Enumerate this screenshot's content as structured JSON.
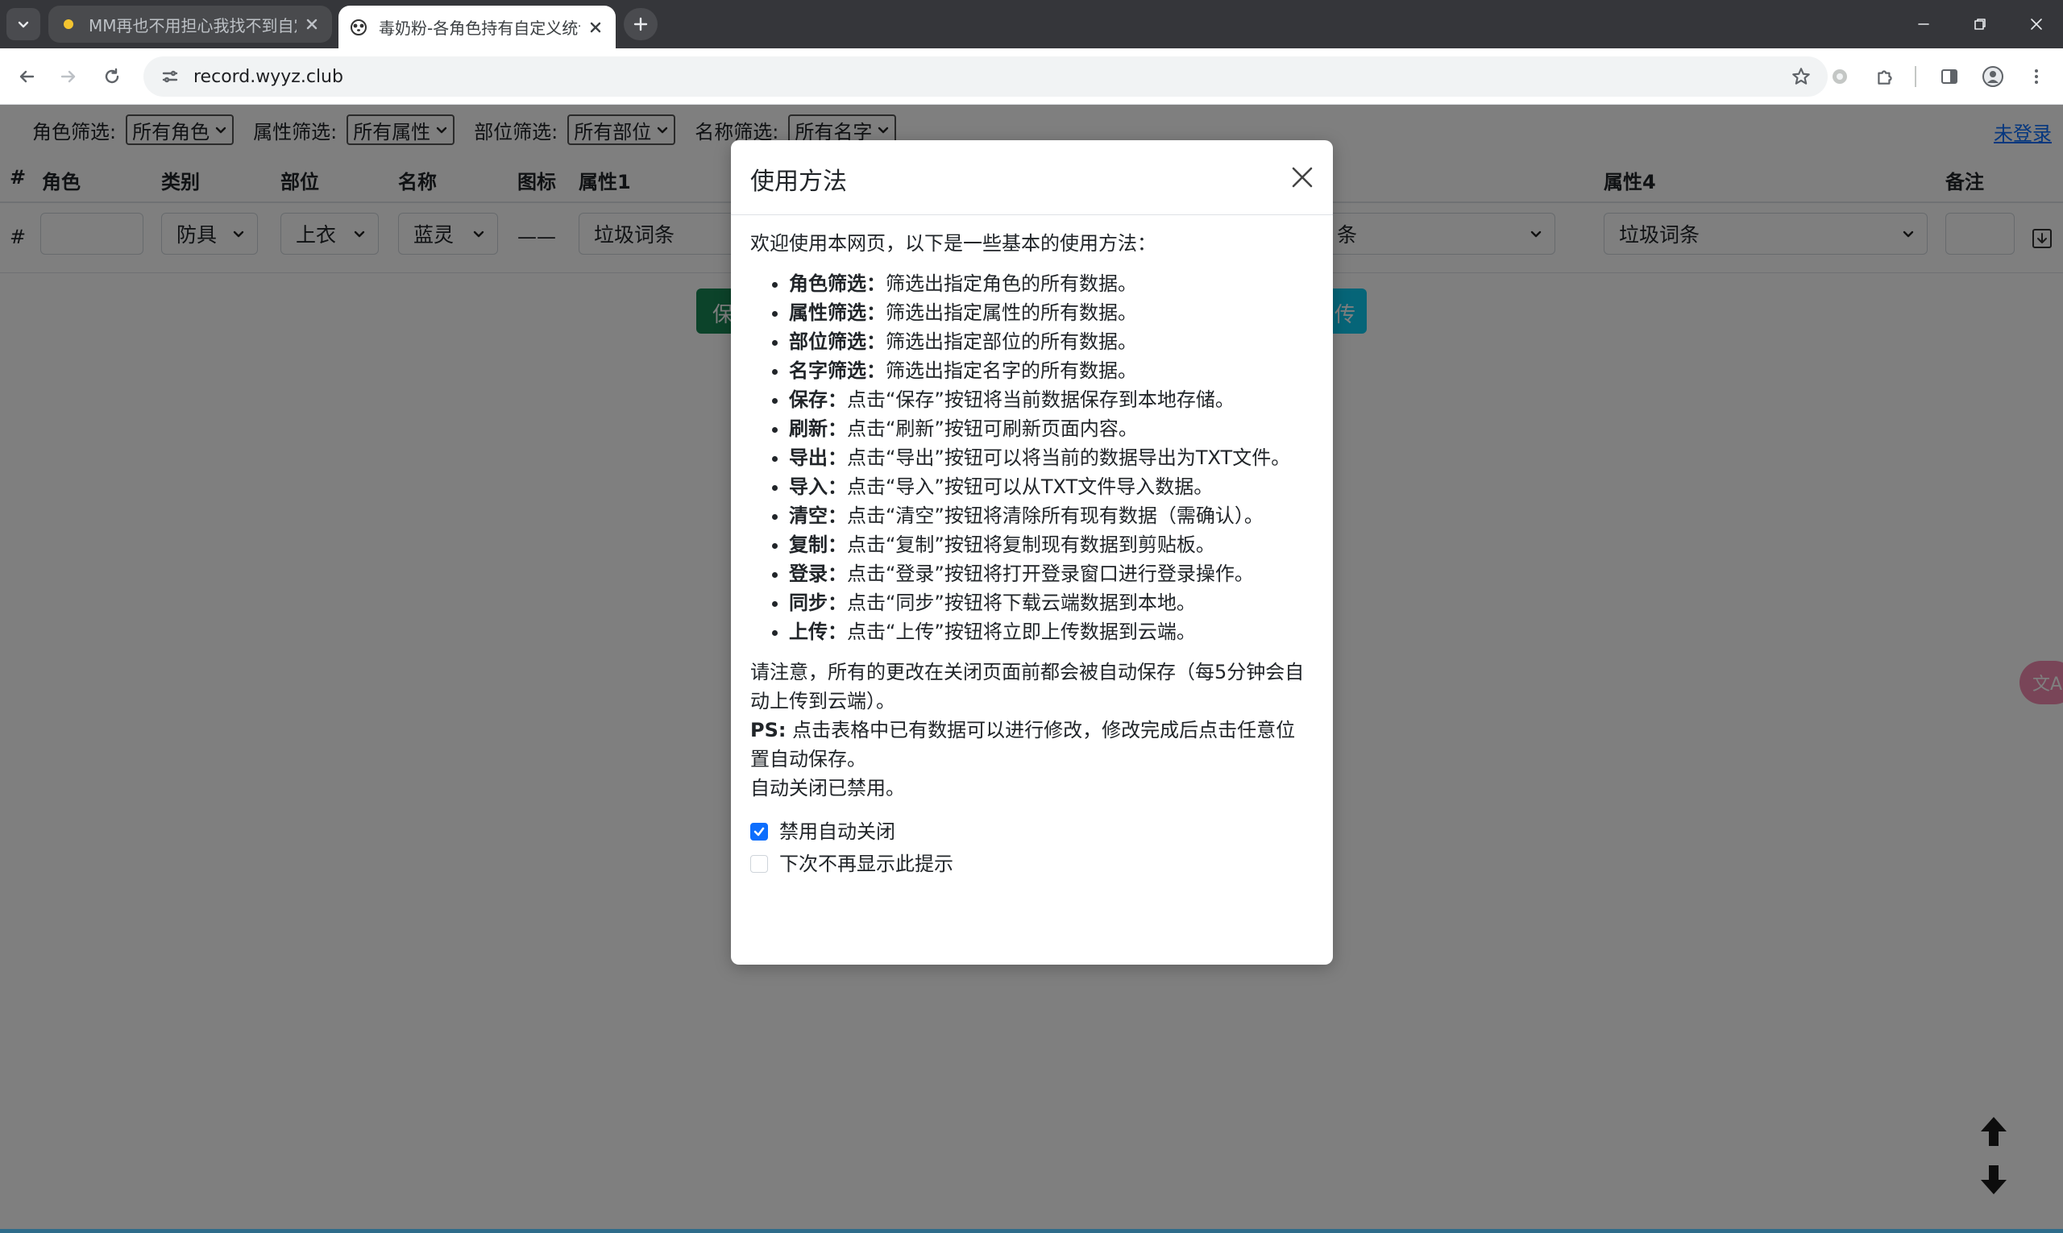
{
  "browser": {
    "tabs": [
      {
        "title": "MM再也不用担心我找不到自定",
        "active": false
      },
      {
        "title": "毒奶粉-各角色持有自定义统计",
        "active": true
      }
    ],
    "url": "record.wyyz.club"
  },
  "page": {
    "filters": [
      {
        "label": "角色筛选:",
        "value": "所有角色"
      },
      {
        "label": "属性筛选:",
        "value": "所有属性"
      },
      {
        "label": "部位筛选:",
        "value": "所有部位"
      },
      {
        "label": "名称筛选:",
        "value": "所有名字"
      }
    ],
    "login_link": "未登录",
    "table": {
      "headers": {
        "num": "#",
        "role": "角色",
        "category": "类别",
        "slot": "部位",
        "name": "名称",
        "icon": "图标",
        "attr1": "属性1",
        "attr4": "属性4",
        "note": "备注"
      },
      "input_row": {
        "num": "#",
        "category": "防具",
        "slot": "上衣",
        "name": "蓝灵",
        "icon": "——",
        "attr1": "垃圾词条",
        "attr3_partial": "条",
        "attr4": "垃圾词条"
      }
    },
    "buttons": {
      "save_partial": "保",
      "upload_partial": "传"
    },
    "translate_fab": "文A"
  },
  "modal": {
    "title": "使用方法",
    "intro": "欢迎使用本网页，以下是一些基本的使用方法：",
    "items": [
      {
        "key": "角色筛选：",
        "desc": "筛选出指定角色的所有数据。"
      },
      {
        "key": "属性筛选：",
        "desc": "筛选出指定属性的所有数据。"
      },
      {
        "key": "部位筛选：",
        "desc": "筛选出指定部位的所有数据。"
      },
      {
        "key": "名字筛选：",
        "desc": "筛选出指定名字的所有数据。"
      },
      {
        "key": "保存：",
        "desc": "点击“保存”按钮将当前数据保存到本地存储。"
      },
      {
        "key": "刷新：",
        "desc": "点击“刷新”按钮可刷新页面内容。"
      },
      {
        "key": "导出：",
        "desc": "点击“导出”按钮可以将当前的数据导出为TXT文件。"
      },
      {
        "key": "导入：",
        "desc": "点击“导入”按钮可以从TXT文件导入数据。"
      },
      {
        "key": "清空：",
        "desc": "点击“清空”按钮将清除所有现有数据（需确认）。"
      },
      {
        "key": "复制：",
        "desc": "点击“复制”按钮将复制现有数据到剪贴板。"
      },
      {
        "key": "登录：",
        "desc": "点击“登录”按钮将打开登录窗口进行登录操作。"
      },
      {
        "key": "同步：",
        "desc": "点击“同步”按钮将下载云端数据到本地。"
      },
      {
        "key": "上传：",
        "desc": "点击“上传”按钮将立即上传数据到云端。"
      }
    ],
    "note": "请注意，所有的更改在关闭页面前都会被自动保存（每5分钟会自动上传到云端）。",
    "ps_label": "PS:",
    "ps_text": " 点击表格中已有数据可以进行修改，修改完成后点击任意位置自动保存。",
    "auto_close_status": "自动关闭已禁用。",
    "checkboxes": [
      {
        "label": "禁用自动关闭",
        "checked": true
      },
      {
        "label": "下次不再显示此提示",
        "checked": false
      }
    ]
  },
  "colors": {
    "primary": "#0d6efd",
    "success": "#198754",
    "info": "#0dcaf0",
    "translate_fab": "#f28ab0"
  }
}
